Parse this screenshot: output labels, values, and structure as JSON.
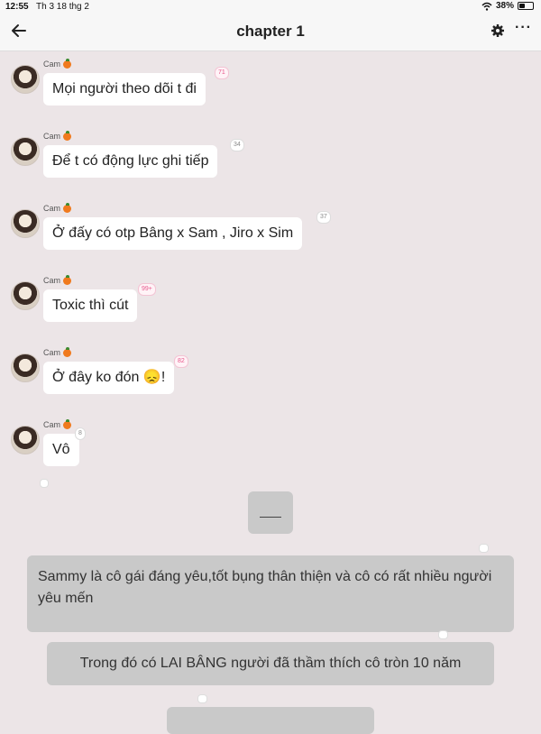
{
  "status": {
    "time": "12:55",
    "date": "Th 3 18 thg 2",
    "battery": "38%"
  },
  "header": {
    "title": "chapter 1"
  },
  "colors": {
    "background": "#ece5e7",
    "bubble": "#ffffff",
    "story_bubble": "#c9c9c9",
    "badge_pink": "#e6568a"
  },
  "messages": [
    {
      "sender": "Cam",
      "text": "Mọi người theo dõi t đi",
      "count": "71"
    },
    {
      "sender": "Cam",
      "text": "Để t có động lực ghi tiếp",
      "count": "34"
    },
    {
      "sender": "Cam",
      "text": "Ở đấy có otp Bâng x Sam , Jiro x Sim",
      "count": "37"
    },
    {
      "sender": "Cam",
      "text": "Toxic thì cút",
      "count": "99+"
    },
    {
      "sender": "Cam",
      "text": "Ở đây ko đón 😞!",
      "count": "82"
    },
    {
      "sender": "Cam",
      "text": "Vô",
      "count": "8"
    }
  ],
  "story": [
    {
      "text": "Sammy là cô gái đáng yêu,tốt bụng thân thiện và cô có rất nhiều người yêu mến"
    },
    {
      "text": "Trong đó có LAI BÂNG người đã thầm thích cô tròn 10 năm"
    }
  ]
}
